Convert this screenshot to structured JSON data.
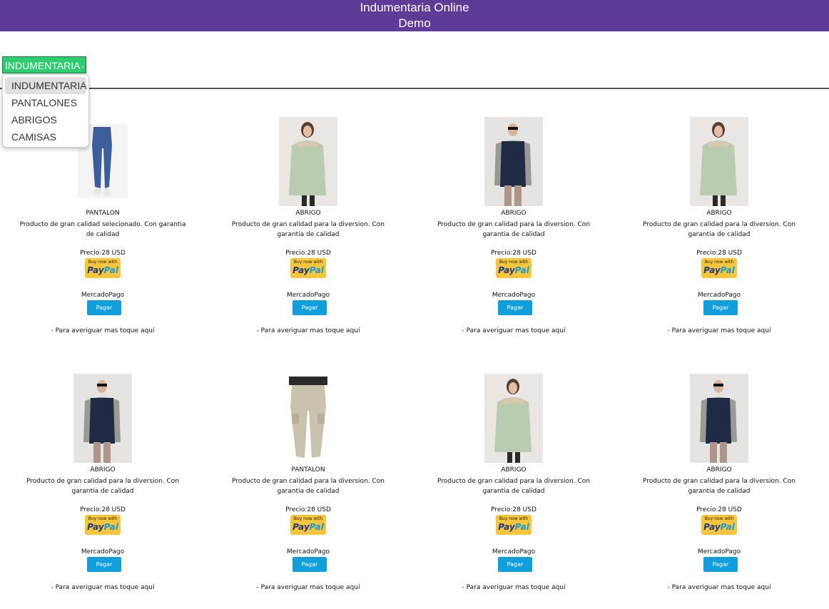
{
  "header": {
    "title_line1": "Indumentaria Online",
    "title_line2": "Demo",
    "bg_color": "#5e3b96"
  },
  "category_select": {
    "selected": "INDUMENTARIA",
    "options": [
      "INDUMENTARIA",
      "PANTALONES",
      "ABRIGOS",
      "CAMISAS"
    ],
    "bg_color": "#2ecc71"
  },
  "products": [
    {
      "name": "PANTALON",
      "description": "Producto de gran calidad selecionado. Con garantia de calidad",
      "price": "Precio:28 USD",
      "paypal_small": "Buy now with",
      "paypal_pay": "Pay",
      "paypal_pal": "Pal",
      "mercadopago_label": "MercadoPago",
      "pay_button": "Pagar",
      "more_info": "- Para averiguar mas toque aquí",
      "image": "jeans"
    },
    {
      "name": "ABRIGO",
      "description": "Producto de gran calidad para la diversion. Con garantia de calidad",
      "price": "Precio:28 USD",
      "paypal_small": "Buy now with",
      "paypal_pay": "Pay",
      "paypal_pal": "Pal",
      "mercadopago_label": "MercadoPago",
      "pay_button": "Pagar",
      "more_info": "- Para averiguar mas toque aquí",
      "image": "green-jacket"
    },
    {
      "name": "ABRIGO",
      "description": "Producto de gran calidad para la diversion. Con garantia de calidad",
      "price": "Precio:28 USD",
      "paypal_small": "Buy now with",
      "paypal_pay": "Pay",
      "paypal_pal": "Pal",
      "mercadopago_label": "MercadoPago",
      "pay_button": "Pagar",
      "more_info": "- Para averiguar mas toque aquí",
      "image": "navy-vest"
    },
    {
      "name": "ABRIGO",
      "description": "Producto de gran calidad para la diversion. Con garantia de calidad",
      "price": "Precio:28 USD",
      "paypal_small": "Buy now with",
      "paypal_pay": "Pay",
      "paypal_pal": "Pal",
      "mercadopago_label": "MercadoPago",
      "pay_button": "Pagar",
      "more_info": "- Para averiguar mas toque aquí",
      "image": "green-jacket"
    },
    {
      "name": "ABRIGO",
      "description": "Producto de gran calidad para la diversion. Con garantia de calidad",
      "price": "Precio:28 USD",
      "paypal_small": "Buy now with",
      "paypal_pay": "Pay",
      "paypal_pal": "Pal",
      "mercadopago_label": "MercadoPago",
      "pay_button": "Pagar",
      "more_info": "- Para averiguar mas toque aquí",
      "image": "navy-vest"
    },
    {
      "name": "PANTALON",
      "description": "Producto de gran calidad para la diversion. Con garantia de calidad",
      "price": "Precio:28 USD",
      "paypal_small": "Buy now with",
      "paypal_pay": "Pay",
      "paypal_pal": "Pal",
      "mercadopago_label": "MercadoPago",
      "pay_button": "Pagar",
      "more_info": "- Para averiguar mas toque aquí",
      "image": "cargo-pants"
    },
    {
      "name": "ABRIGO",
      "description": "Producto de gran calidad para la diversion. Con garantia de calidad",
      "price": "Precio:28 USD",
      "paypal_small": "Buy now with",
      "paypal_pay": "Pay",
      "paypal_pal": "Pal",
      "mercadopago_label": "MercadoPago",
      "pay_button": "Pagar",
      "more_info": "- Para averiguar mas toque aquí",
      "image": "green-jacket"
    },
    {
      "name": "ABRIGO",
      "description": "Producto de gran calidad para la diversion. Con garantia de calidad",
      "price": "Precio:28 USD",
      "paypal_small": "Buy now with",
      "paypal_pay": "Pay",
      "paypal_pal": "Pal",
      "mercadopago_label": "MercadoPago",
      "pay_button": "Pagar",
      "more_info": "- Para averiguar mas toque aquí",
      "image": "navy-vest"
    }
  ]
}
